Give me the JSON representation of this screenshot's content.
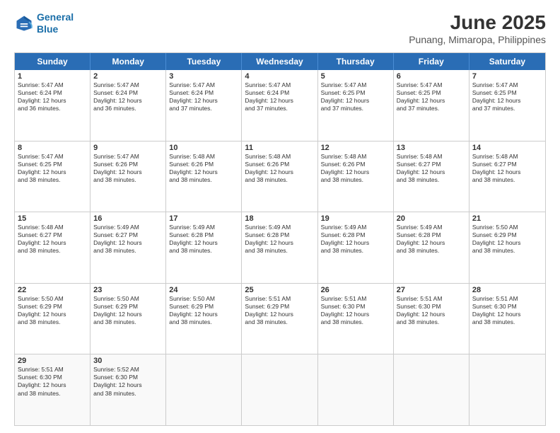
{
  "logo": {
    "line1": "General",
    "line2": "Blue"
  },
  "title": "June 2025",
  "subtitle": "Punang, Mimaropa, Philippines",
  "header_days": [
    "Sunday",
    "Monday",
    "Tuesday",
    "Wednesday",
    "Thursday",
    "Friday",
    "Saturday"
  ],
  "weeks": [
    [
      {
        "day": "1",
        "text": "Sunrise: 5:47 AM\nSunset: 6:24 PM\nDaylight: 12 hours\nand 36 minutes."
      },
      {
        "day": "2",
        "text": "Sunrise: 5:47 AM\nSunset: 6:24 PM\nDaylight: 12 hours\nand 36 minutes."
      },
      {
        "day": "3",
        "text": "Sunrise: 5:47 AM\nSunset: 6:24 PM\nDaylight: 12 hours\nand 37 minutes."
      },
      {
        "day": "4",
        "text": "Sunrise: 5:47 AM\nSunset: 6:24 PM\nDaylight: 12 hours\nand 37 minutes."
      },
      {
        "day": "5",
        "text": "Sunrise: 5:47 AM\nSunset: 6:25 PM\nDaylight: 12 hours\nand 37 minutes."
      },
      {
        "day": "6",
        "text": "Sunrise: 5:47 AM\nSunset: 6:25 PM\nDaylight: 12 hours\nand 37 minutes."
      },
      {
        "day": "7",
        "text": "Sunrise: 5:47 AM\nSunset: 6:25 PM\nDaylight: 12 hours\nand 37 minutes."
      }
    ],
    [
      {
        "day": "8",
        "text": "Sunrise: 5:47 AM\nSunset: 6:25 PM\nDaylight: 12 hours\nand 38 minutes."
      },
      {
        "day": "9",
        "text": "Sunrise: 5:47 AM\nSunset: 6:26 PM\nDaylight: 12 hours\nand 38 minutes."
      },
      {
        "day": "10",
        "text": "Sunrise: 5:48 AM\nSunset: 6:26 PM\nDaylight: 12 hours\nand 38 minutes."
      },
      {
        "day": "11",
        "text": "Sunrise: 5:48 AM\nSunset: 6:26 PM\nDaylight: 12 hours\nand 38 minutes."
      },
      {
        "day": "12",
        "text": "Sunrise: 5:48 AM\nSunset: 6:26 PM\nDaylight: 12 hours\nand 38 minutes."
      },
      {
        "day": "13",
        "text": "Sunrise: 5:48 AM\nSunset: 6:27 PM\nDaylight: 12 hours\nand 38 minutes."
      },
      {
        "day": "14",
        "text": "Sunrise: 5:48 AM\nSunset: 6:27 PM\nDaylight: 12 hours\nand 38 minutes."
      }
    ],
    [
      {
        "day": "15",
        "text": "Sunrise: 5:48 AM\nSunset: 6:27 PM\nDaylight: 12 hours\nand 38 minutes."
      },
      {
        "day": "16",
        "text": "Sunrise: 5:49 AM\nSunset: 6:27 PM\nDaylight: 12 hours\nand 38 minutes."
      },
      {
        "day": "17",
        "text": "Sunrise: 5:49 AM\nSunset: 6:28 PM\nDaylight: 12 hours\nand 38 minutes."
      },
      {
        "day": "18",
        "text": "Sunrise: 5:49 AM\nSunset: 6:28 PM\nDaylight: 12 hours\nand 38 minutes."
      },
      {
        "day": "19",
        "text": "Sunrise: 5:49 AM\nSunset: 6:28 PM\nDaylight: 12 hours\nand 38 minutes."
      },
      {
        "day": "20",
        "text": "Sunrise: 5:49 AM\nSunset: 6:28 PM\nDaylight: 12 hours\nand 38 minutes."
      },
      {
        "day": "21",
        "text": "Sunrise: 5:50 AM\nSunset: 6:29 PM\nDaylight: 12 hours\nand 38 minutes."
      }
    ],
    [
      {
        "day": "22",
        "text": "Sunrise: 5:50 AM\nSunset: 6:29 PM\nDaylight: 12 hours\nand 38 minutes."
      },
      {
        "day": "23",
        "text": "Sunrise: 5:50 AM\nSunset: 6:29 PM\nDaylight: 12 hours\nand 38 minutes."
      },
      {
        "day": "24",
        "text": "Sunrise: 5:50 AM\nSunset: 6:29 PM\nDaylight: 12 hours\nand 38 minutes."
      },
      {
        "day": "25",
        "text": "Sunrise: 5:51 AM\nSunset: 6:29 PM\nDaylight: 12 hours\nand 38 minutes."
      },
      {
        "day": "26",
        "text": "Sunrise: 5:51 AM\nSunset: 6:30 PM\nDaylight: 12 hours\nand 38 minutes."
      },
      {
        "day": "27",
        "text": "Sunrise: 5:51 AM\nSunset: 6:30 PM\nDaylight: 12 hours\nand 38 minutes."
      },
      {
        "day": "28",
        "text": "Sunrise: 5:51 AM\nSunset: 6:30 PM\nDaylight: 12 hours\nand 38 minutes."
      }
    ],
    [
      {
        "day": "29",
        "text": "Sunrise: 5:51 AM\nSunset: 6:30 PM\nDaylight: 12 hours\nand 38 minutes."
      },
      {
        "day": "30",
        "text": "Sunrise: 5:52 AM\nSunset: 6:30 PM\nDaylight: 12 hours\nand 38 minutes."
      },
      {
        "day": "",
        "text": ""
      },
      {
        "day": "",
        "text": ""
      },
      {
        "day": "",
        "text": ""
      },
      {
        "day": "",
        "text": ""
      },
      {
        "day": "",
        "text": ""
      }
    ]
  ]
}
